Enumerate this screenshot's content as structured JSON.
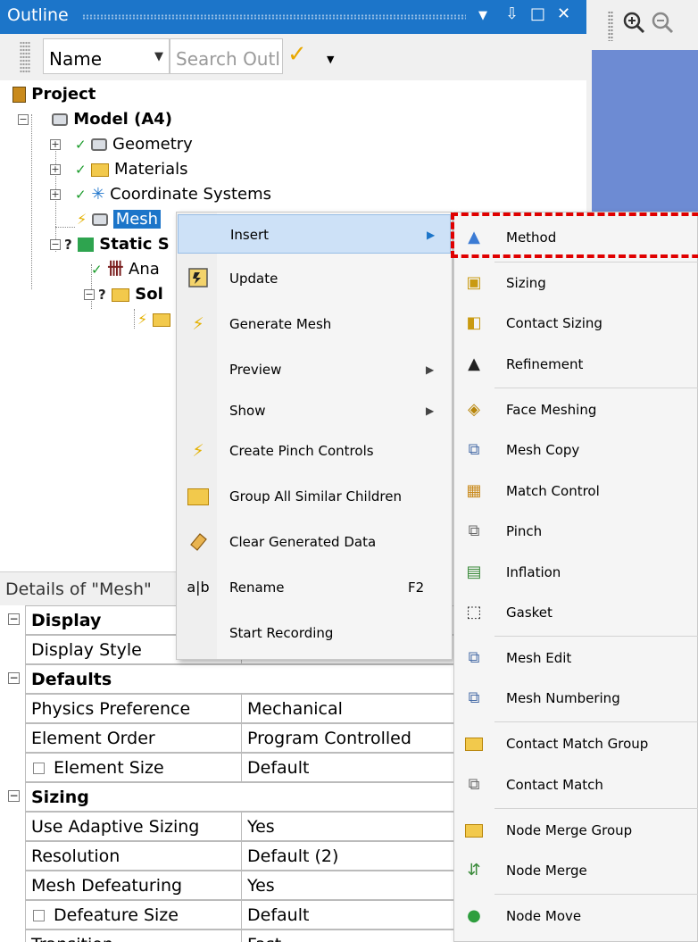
{
  "outline_panel": {
    "title": "Outline",
    "controls": [
      "▼",
      "⇩",
      "□",
      "✕"
    ]
  },
  "filter_bar": {
    "name_select": "Name",
    "search_placeholder": "Search Outl"
  },
  "tree": {
    "project": "Project",
    "model": "Model (A4)",
    "geometry": "Geometry",
    "materials": "Materials",
    "coordinate_systems": "Coordinate Systems",
    "mesh": "Mesh",
    "static": "Static S",
    "analysis": "Ana",
    "solution": "Sol"
  },
  "details": {
    "title": "Details of \"Mesh\"",
    "rows": [
      {
        "type": "category",
        "label": "Display"
      },
      {
        "type": "prop",
        "label": "Display Style",
        "value": ""
      },
      {
        "type": "category",
        "label": "Defaults"
      },
      {
        "type": "prop",
        "label": "Physics Preference",
        "value": "Mechanical"
      },
      {
        "type": "prop",
        "label": "Element Order",
        "value": "Program Controlled"
      },
      {
        "type": "checkprop",
        "label": "Element Size",
        "value": "Default"
      },
      {
        "type": "category",
        "label": "Sizing"
      },
      {
        "type": "prop",
        "label": "Use Adaptive Sizing",
        "value": "Yes"
      },
      {
        "type": "prop",
        "label": "Resolution",
        "value": "Default (2)"
      },
      {
        "type": "prop",
        "label": "Mesh Defeaturing",
        "value": "Yes"
      },
      {
        "type": "checkprop",
        "label": "Defeature Size",
        "value": "Default"
      },
      {
        "type": "prop",
        "label": "Transition",
        "value": "Fast"
      }
    ]
  },
  "context_menu": {
    "items": [
      {
        "label": "Insert",
        "submenu": true
      },
      {
        "label": "Update",
        "icon": "update-icon"
      },
      {
        "label": "Generate Mesh",
        "icon": "lightning-icon"
      },
      {
        "label": "Preview",
        "submenu": true
      },
      {
        "label": "Show",
        "submenu": true
      },
      {
        "label": "Create Pinch Controls",
        "icon": "lightning-icon"
      },
      {
        "label": "Group All Similar Children",
        "icon": "folder-icon"
      },
      {
        "label": "Clear Generated Data",
        "icon": "eraser-icon"
      },
      {
        "label": "Rename",
        "shortcut": "F2",
        "icon": "rename-icon"
      },
      {
        "label": "Start Recording"
      }
    ]
  },
  "insert_submenu": {
    "items": [
      {
        "label": "Method",
        "icon": "method-icon"
      },
      {
        "label": "Sizing",
        "icon": "sizing-icon"
      },
      {
        "label": "Contact Sizing",
        "icon": "contact-sizing-icon"
      },
      {
        "label": "Refinement",
        "icon": "refinement-icon"
      },
      {
        "label": "Face Meshing",
        "icon": "face-meshing-icon"
      },
      {
        "label": "Mesh Copy",
        "icon": "mesh-copy-icon"
      },
      {
        "label": "Match Control",
        "icon": "match-control-icon"
      },
      {
        "label": "Pinch",
        "icon": "pinch-icon"
      },
      {
        "label": "Inflation",
        "icon": "inflation-icon"
      },
      {
        "label": "Gasket",
        "icon": "gasket-icon"
      },
      {
        "label": "Mesh Edit",
        "icon": "mesh-edit-icon"
      },
      {
        "label": "Mesh Numbering",
        "icon": "mesh-numbering-icon"
      },
      {
        "label": "Contact Match Group",
        "icon": "contact-match-group-icon"
      },
      {
        "label": "Contact Match",
        "icon": "contact-match-icon"
      },
      {
        "label": "Node Merge Group",
        "icon": "node-merge-group-icon"
      },
      {
        "label": "Node Merge",
        "icon": "node-merge-icon"
      },
      {
        "label": "Node Move",
        "icon": "node-move-icon"
      }
    ]
  },
  "colors": {
    "title_bar": "#1c75c9",
    "selection": "#1c75c9",
    "menu_highlight": "#cde1f7",
    "annotation": "#e00000",
    "viewport": "#6d8bd3"
  }
}
